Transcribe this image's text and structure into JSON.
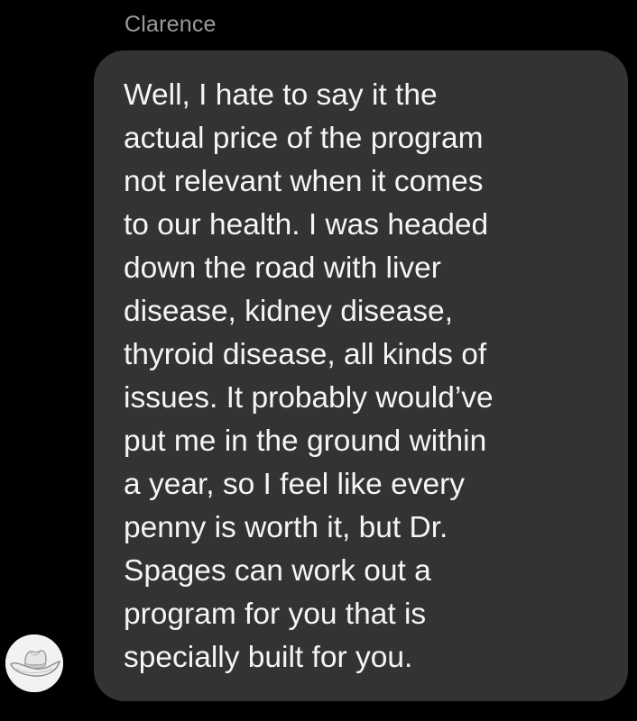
{
  "thread": {
    "sender_name": "Clarence"
  },
  "message": {
    "lines": [
      "Well, I hate to say it the",
      "actual price of the program",
      "not relevant when it comes",
      "to our health. I was headed",
      "down the road with liver",
      "disease, kidney disease,",
      "thyroid disease, all kinds of",
      "issues. It probably would’ve",
      "put me in the ground within",
      "a year, so I feel like every",
      "penny is worth it, but Dr.",
      "Spages can work out a",
      "program for you that is",
      "specially built for you."
    ]
  },
  "avatar": {
    "icon": "cowboy-hat-icon",
    "background_color": "#f2f2f2"
  },
  "colors": {
    "page_background": "#000000",
    "bubble_background": "#333333",
    "message_text": "#f5f5f5",
    "sender_text": "#9a9a9a"
  }
}
